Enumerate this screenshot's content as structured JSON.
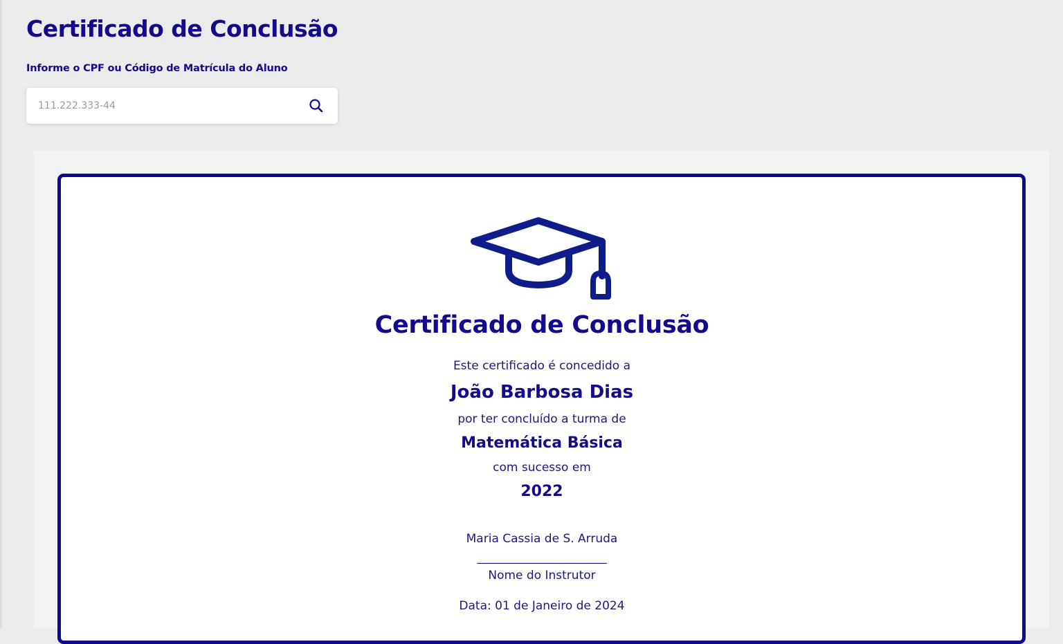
{
  "header": {
    "title": "Certificado de Conclusão",
    "search_label": "Informe o CPF ou Código de Matrícula do Aluno",
    "search_placeholder": "111.222.333-44",
    "search_icon": "search-icon"
  },
  "certificate": {
    "icon": "graduation-cap-icon",
    "title": "Certificado de Conclusão",
    "granted_text": "Este certificado é concedido a",
    "student_name": "João Barbosa Dias",
    "completed_text": "por ter concluído a turma de",
    "course_name": "Matemática Básica",
    "success_text": "com sucesso em",
    "year": "2022",
    "instructor_name": "Maria Cassia de S. Arruda",
    "signature_line": "______________________",
    "instructor_label": "Nome do Instrutor",
    "date_text": "Data: 01 de Janeiro de 2024"
  },
  "colors": {
    "primary": "#140b8c",
    "border": "#0f0990",
    "page_background": "#ebebeb",
    "panel_background": "#f1f2f4"
  }
}
